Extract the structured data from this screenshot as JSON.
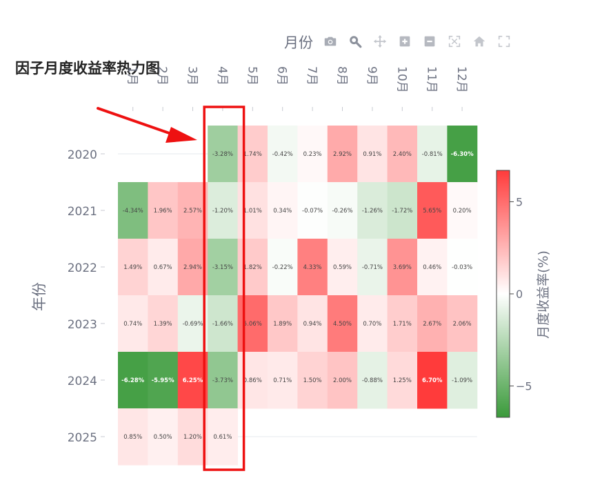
{
  "chart_data": {
    "type": "heatmap",
    "title": "因子月度收益率热力图",
    "xlabel": "月份",
    "ylabel": "年份",
    "colorbar_title": "月度收益率(%)",
    "x": [
      "1月",
      "2月",
      "3月",
      "4月",
      "5月",
      "6月",
      "7月",
      "8月",
      "9月",
      "10月",
      "11月",
      "12月"
    ],
    "y": [
      "2020",
      "2021",
      "2022",
      "2023",
      "2024",
      "2025"
    ],
    "z": [
      [
        null,
        null,
        null,
        -3.28,
        1.74,
        -0.42,
        0.23,
        2.92,
        0.91,
        2.4,
        -0.81,
        -6.3
      ],
      [
        -4.34,
        1.96,
        2.57,
        -1.2,
        1.01,
        0.34,
        -0.07,
        -0.26,
        -1.26,
        -1.72,
        5.65,
        0.2
      ],
      [
        1.49,
        0.67,
        2.94,
        -3.15,
        1.82,
        -0.22,
        4.33,
        0.59,
        -0.71,
        3.69,
        0.46,
        -0.03
      ],
      [
        0.74,
        1.39,
        -0.69,
        -1.66,
        5.06,
        1.89,
        0.94,
        4.5,
        0.7,
        1.71,
        2.67,
        2.06
      ],
      [
        -6.28,
        -5.95,
        6.25,
        -3.73,
        0.86,
        0.71,
        1.5,
        2.0,
        -0.88,
        1.25,
        6.7,
        -1.09
      ],
      [
        0.85,
        0.5,
        1.2,
        0.61,
        null,
        null,
        null,
        null,
        null,
        null,
        null,
        null
      ]
    ],
    "text": [
      [
        "",
        "",
        "",
        "-3.28%",
        "1.74%",
        "-0.42%",
        "0.23%",
        "2.92%",
        "0.91%",
        "2.40%",
        "-0.81%",
        "-6.30%"
      ],
      [
        "-4.34%",
        "1.96%",
        "2.57%",
        "-1.20%",
        "1.01%",
        "0.34%",
        "-0.07%",
        "-0.26%",
        "-1.26%",
        "-1.72%",
        "5.65%",
        "0.20%"
      ],
      [
        "1.49%",
        "0.67%",
        "2.94%",
        "-3.15%",
        "1.82%",
        "-0.22%",
        "4.33%",
        "0.59%",
        "-0.71%",
        "3.69%",
        "0.46%",
        "-0.03%"
      ],
      [
        "0.74%",
        "1.39%",
        "-0.69%",
        "-1.66%",
        "5.06%",
        "1.89%",
        "0.94%",
        "4.50%",
        "0.70%",
        "1.71%",
        "2.67%",
        "2.06%"
      ],
      [
        "-6.28%",
        "-5.95%",
        "6.25%",
        "-3.73%",
        "0.86%",
        "0.71%",
        "1.50%",
        "2.00%",
        "-0.88%",
        "1.25%",
        "6.70%",
        "-1.09%"
      ],
      [
        "0.85%",
        "0.50%",
        "1.20%",
        "0.61%",
        "",
        "",
        "",
        "",
        "",
        "",
        "",
        ""
      ]
    ],
    "zmin": -6.7,
    "zmax": 6.7,
    "colorscale": [
      "#3a9a3a",
      "#ffffff",
      "#ff3b3b"
    ],
    "colorbar_ticks": [
      5,
      0,
      -5
    ],
    "colorbar_tick_labels": [
      "5",
      "0",
      "−5"
    ],
    "x_axis_side": "top",
    "x_tick_angle": 90,
    "grid": true,
    "highlight": {
      "column": "4月",
      "color": "#ee1111"
    }
  },
  "annotation": {
    "color": "#ee1111"
  },
  "modebar": {
    "icons": [
      "camera-icon",
      "zoom-icon",
      "pan-icon",
      "zoom-in-icon",
      "zoom-out-icon",
      "autoscale-icon",
      "home-icon",
      "fullscreen-icon"
    ],
    "color": "#a8acb5"
  },
  "colors": {
    "axis_text": "#6b7080",
    "title_text": "#222222",
    "cell_text": "#444444"
  }
}
